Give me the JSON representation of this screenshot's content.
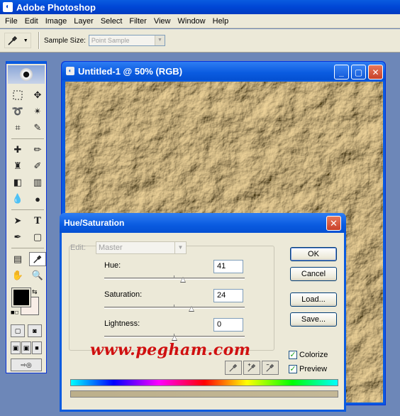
{
  "app": {
    "title": "Adobe Photoshop",
    "icon": "ps-app-icon"
  },
  "menu": [
    "File",
    "Edit",
    "Image",
    "Layer",
    "Select",
    "Filter",
    "View",
    "Window",
    "Help"
  ],
  "options_bar": {
    "sample_size_label": "Sample Size:",
    "sample_size_value": "Point Sample"
  },
  "document": {
    "title": "Untitled-1 @ 50% (RGB)",
    "texture_color": "#9c8a64"
  },
  "dialog": {
    "title": "Hue/Saturation",
    "edit_label": "Edit:",
    "edit_value": "Master",
    "sliders": [
      {
        "label": "Hue:",
        "value": "41",
        "fraction": 0.56
      },
      {
        "label": "Saturation:",
        "value": "24",
        "fraction": 0.62
      },
      {
        "label": "Lightness:",
        "value": "0",
        "fraction": 0.5
      }
    ],
    "buttons": {
      "ok": "OK",
      "cancel": "Cancel",
      "load": "Load...",
      "save": "Save..."
    },
    "colorize_label": "Colorize",
    "colorize_checked": true,
    "preview_label": "Preview",
    "preview_checked": true,
    "watermark": "www.pegham.com"
  },
  "colors": {
    "titlebar": "#0a5be0",
    "dialog_bg": "#ece9d8",
    "watermark": "#d01010"
  }
}
